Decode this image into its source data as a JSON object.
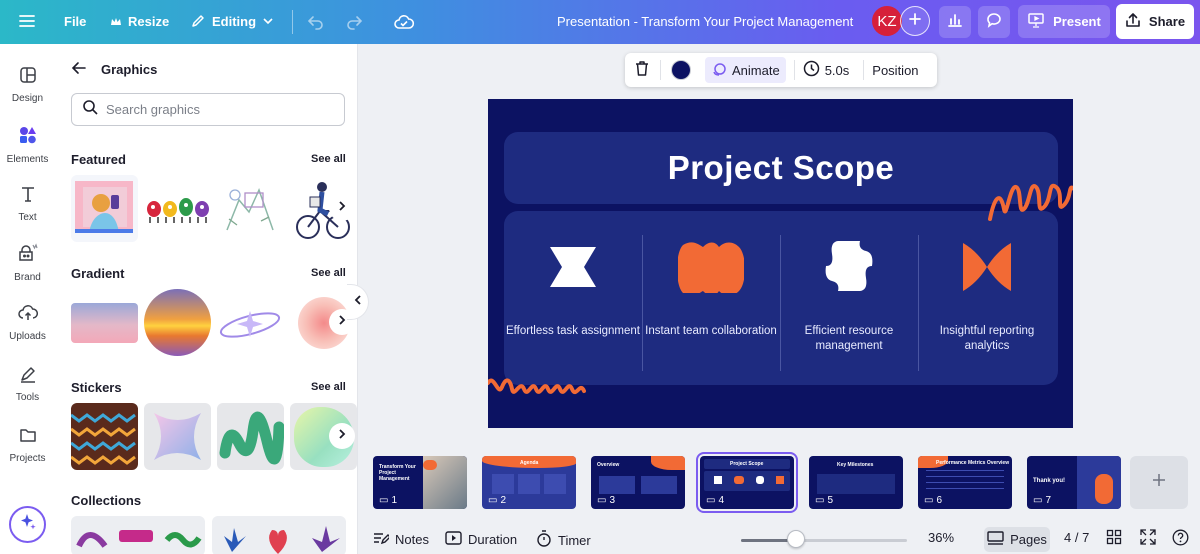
{
  "topbar": {
    "file_label": "File",
    "resize_label": "Resize",
    "editing_label": "Editing",
    "doc_title": "Presentation - Transform Your Project Management",
    "avatar_initials": "KZ",
    "present_label": "Present",
    "share_label": "Share"
  },
  "rail": {
    "items": [
      {
        "label": "Design",
        "icon": "layout-icon"
      },
      {
        "label": "Elements",
        "icon": "shapes-icon"
      },
      {
        "label": "Text",
        "icon": "text-icon"
      },
      {
        "label": "Brand",
        "icon": "brand-icon"
      },
      {
        "label": "Uploads",
        "icon": "cloud-upload-icon"
      },
      {
        "label": "Tools",
        "icon": "pen-tool-icon"
      },
      {
        "label": "Projects",
        "icon": "folder-icon"
      }
    ],
    "active": "Elements"
  },
  "panel": {
    "title": "Graphics",
    "search_placeholder": "Search graphics",
    "sections": [
      {
        "title": "Featured",
        "see_all": "See all"
      },
      {
        "title": "Gradient",
        "see_all": "See all"
      },
      {
        "title": "Stickers",
        "see_all": "See all"
      },
      {
        "title": "Collections"
      }
    ]
  },
  "context_toolbar": {
    "color": "#0c1262",
    "animate_label": "Animate",
    "duration_label": "5.0s",
    "position_label": "Position"
  },
  "slide": {
    "title": "Project Scope",
    "background": "#0c1262",
    "accent": "#f26a35",
    "features": [
      {
        "label": "Effortless task assignment",
        "shape": "hourglass-shape"
      },
      {
        "label": "Instant team collaboration",
        "shape": "wave-blob-shape"
      },
      {
        "label": "Efficient resource management",
        "shape": "badge-shape"
      },
      {
        "label": "Insightful reporting analytics",
        "shape": "bowtie-shape"
      }
    ]
  },
  "pages": {
    "thumbnails": [
      {
        "num": "1",
        "title": "Transform Your Project Management"
      },
      {
        "num": "2",
        "title": "Agenda"
      },
      {
        "num": "3",
        "title": "Overview"
      },
      {
        "num": "4",
        "title": "Project Scope"
      },
      {
        "num": "5",
        "title": "Key Milestones"
      },
      {
        "num": "6",
        "title": "Performance Metrics Overview"
      },
      {
        "num": "7",
        "title": "Thank you!"
      }
    ],
    "active_index": 3
  },
  "bottombar": {
    "notes_label": "Notes",
    "duration_label": "Duration",
    "timer_label": "Timer",
    "zoom_level": "36%",
    "zoom_fraction": 0.36,
    "pages_label": "Pages",
    "page_counter": "4 / 7"
  }
}
